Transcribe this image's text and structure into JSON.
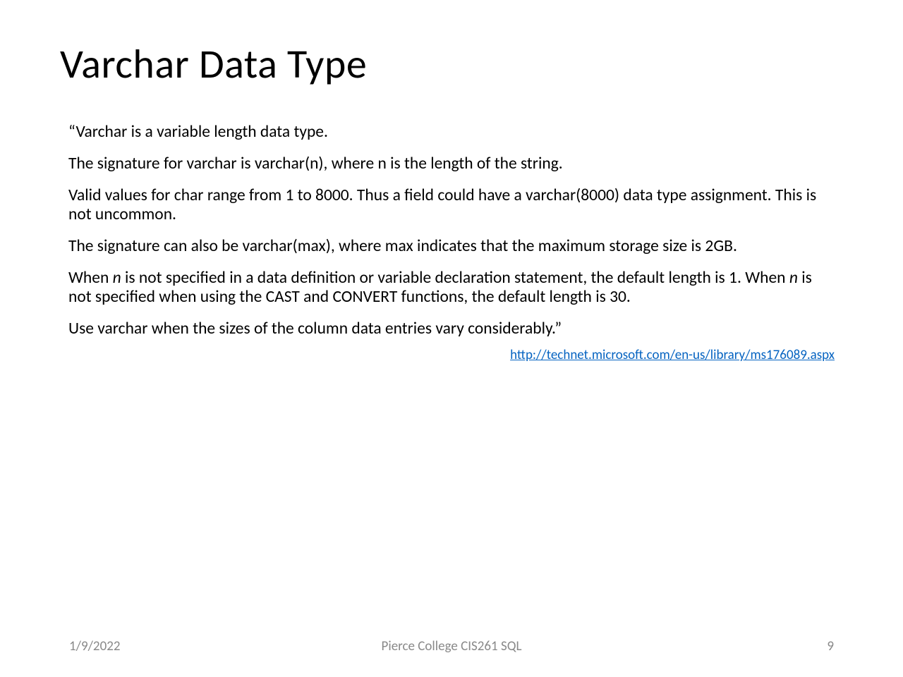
{
  "slide": {
    "title": "Varchar Data Type",
    "paragraphs": {
      "p1": "“Varchar is a variable length data type.",
      "p2": "The signature for varchar is varchar(n), where n is the length of the string.",
      "p3": "Valid values for char range from 1 to 8000. Thus a field could have a varchar(8000) data type assignment. This is not uncommon.",
      "p4": "The signature can also be varchar(max), where max indicates that the maximum storage size is 2GB.",
      "p5_pre": "When ",
      "p5_n1": "n",
      "p5_mid1": " is not specified in a data definition or variable declaration statement, the default length is 1. When ",
      "p5_n2": "n",
      "p5_mid2": " is not specified when using the CAST and CONVERT functions, the default length is 30.",
      "p6": "Use varchar when the sizes of the column data entries vary considerably.”"
    },
    "link_text": "http://technet.microsoft.com/en-us/library/ms176089.aspx",
    "footer": {
      "date": "1/9/2022",
      "center": "Pierce College CIS261 SQL",
      "page": "9"
    }
  }
}
